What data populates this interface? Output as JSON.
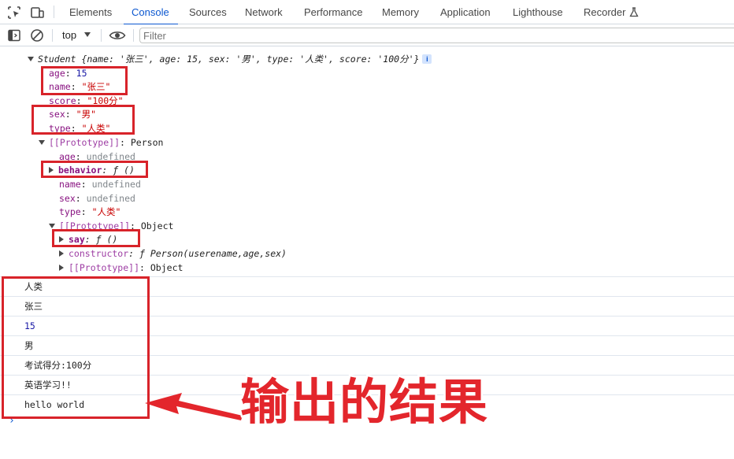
{
  "tabs": [
    {
      "label": "Elements"
    },
    {
      "label": "Console"
    },
    {
      "label": "Sources"
    },
    {
      "label": "Network"
    },
    {
      "label": "Performance"
    },
    {
      "label": "Memory"
    },
    {
      "label": "Application"
    },
    {
      "label": "Lighthouse"
    },
    {
      "label": "Recorder"
    }
  ],
  "active_tab": "Console",
  "icons": {
    "inspect": "inspect-element-icon",
    "device": "device-toolbar-icon",
    "recorder": "flask-icon",
    "sidebar": "sidebar-toggle-icon",
    "clear": "clear-console-icon",
    "eye": "live-expression-eye-icon"
  },
  "toolbar": {
    "context": "top",
    "filter_placeholder": "Filter"
  },
  "object": {
    "summary_prefix": "Student ",
    "summary_body": "{name: '张三', age: 15, sex: '男', type: '人类', score: '100分'}",
    "info_badge": "i",
    "props": [
      {
        "key": "age",
        "sep": ": ",
        "value": "15"
      },
      {
        "key": "name",
        "sep": ": ",
        "value": "\"张三\""
      },
      {
        "key": "score",
        "sep": ": ",
        "value": "\"100分\""
      },
      {
        "key": "sex",
        "sep": ": ",
        "value": "\"男\""
      },
      {
        "key": "type",
        "sep": ": ",
        "value": "\"人类\""
      }
    ],
    "proto1": {
      "key": "[[Prototype]]",
      "sep": ": ",
      "value": "Person",
      "props": [
        {
          "key": "age",
          "sep": ": ",
          "value": "undefined"
        },
        {
          "key": "behavior",
          "sep": ": ",
          "value": "ƒ ()"
        },
        {
          "key": "name",
          "sep": ": ",
          "value": "undefined"
        },
        {
          "key": "sex",
          "sep": ": ",
          "value": "undefined"
        },
        {
          "key": "type",
          "sep": ": ",
          "value": "\"人类\""
        }
      ]
    },
    "proto2": {
      "key": "[[Prototype]]",
      "sep": ": ",
      "value": "Object",
      "props": [
        {
          "key": "say",
          "sep": ": ",
          "value": "ƒ ()"
        },
        {
          "key": "constructor",
          "sep": ": ",
          "value": "ƒ Person(userename,age,sex)"
        },
        {
          "key": "[[Prototype]]",
          "sep": ": ",
          "value": "Object"
        }
      ]
    }
  },
  "messages": [
    {
      "text": "人类"
    },
    {
      "text": "张三"
    },
    {
      "text": "15"
    },
    {
      "text": "男"
    },
    {
      "text": "考试得分:100分"
    },
    {
      "text": "英语学习!!"
    },
    {
      "text": "hello world"
    }
  ],
  "prompt_symbol": "›",
  "annotation": {
    "label": "输出的结果",
    "color": "#e3262c"
  }
}
